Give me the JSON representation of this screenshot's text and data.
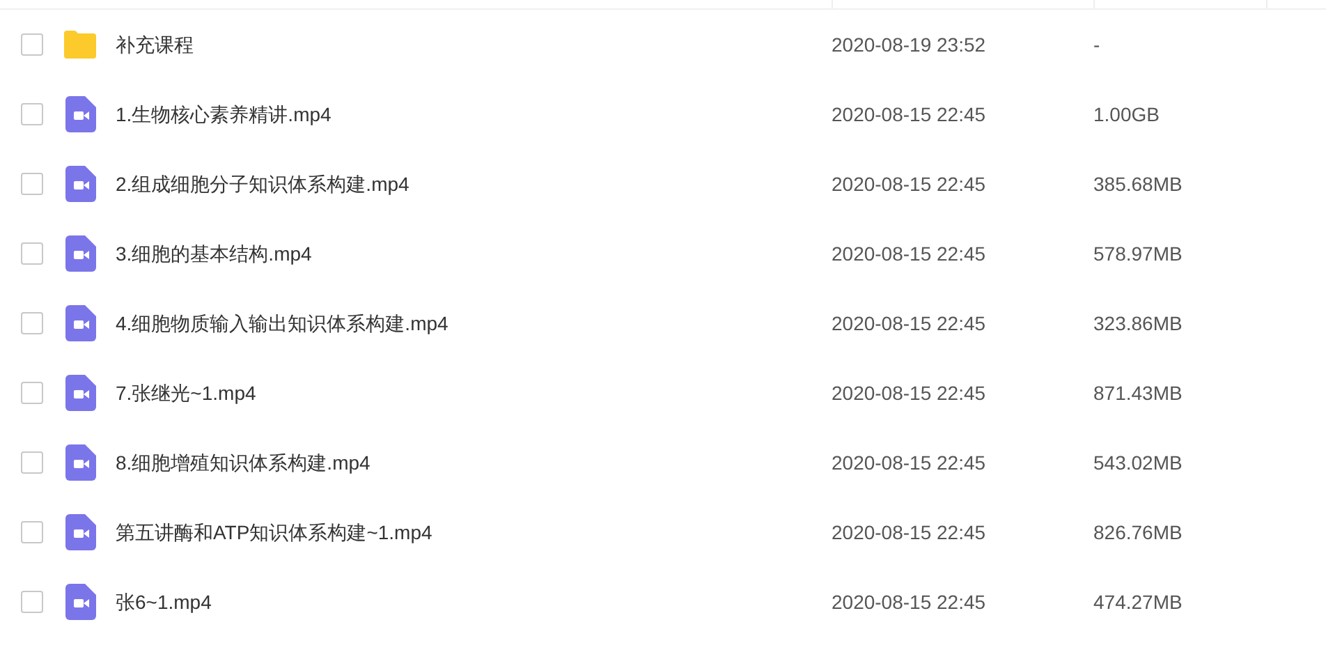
{
  "files": [
    {
      "kind": "folder",
      "name": "补充课程",
      "modified": "2020-08-19 23:52",
      "size": "-",
      "checked": false
    },
    {
      "kind": "video",
      "name": "1.生物核心素养精讲.mp4",
      "modified": "2020-08-15 22:45",
      "size": "1.00GB",
      "checked": false
    },
    {
      "kind": "video",
      "name": "2.组成细胞分子知识体系构建.mp4",
      "modified": "2020-08-15 22:45",
      "size": "385.68MB",
      "checked": false
    },
    {
      "kind": "video",
      "name": "3.细胞的基本结构.mp4",
      "modified": "2020-08-15 22:45",
      "size": "578.97MB",
      "checked": false
    },
    {
      "kind": "video",
      "name": "4.细胞物质输入输出知识体系构建.mp4",
      "modified": "2020-08-15 22:45",
      "size": "323.86MB",
      "checked": false
    },
    {
      "kind": "video",
      "name": "7.张继光~1.mp4",
      "modified": "2020-08-15 22:45",
      "size": "871.43MB",
      "checked": false
    },
    {
      "kind": "video",
      "name": "8.细胞增殖知识体系构建.mp4",
      "modified": "2020-08-15 22:45",
      "size": "543.02MB",
      "checked": false
    },
    {
      "kind": "video",
      "name": "第五讲酶和ATP知识体系构建~1.mp4",
      "modified": "2020-08-15 22:45",
      "size": "826.76MB",
      "checked": false
    },
    {
      "kind": "video",
      "name": "张6~1.mp4",
      "modified": "2020-08-15 22:45",
      "size": "474.27MB",
      "checked": false
    }
  ]
}
